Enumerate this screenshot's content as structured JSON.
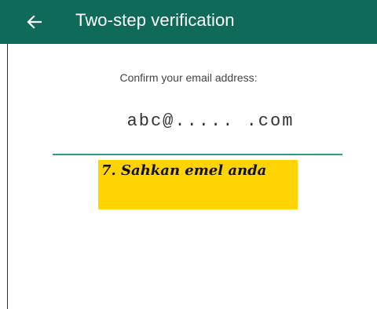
{
  "header": {
    "title": "Two-step verification",
    "back_icon": "arrow-left-icon"
  },
  "main": {
    "prompt": "Confirm your email address:",
    "email_value": "abc@..... .com"
  },
  "annotation": {
    "text": "7. Sahkan emel anda",
    "background": "#ffd400"
  },
  "colors": {
    "appbar": "#0f6a5a",
    "underline": "#2e9a88"
  }
}
